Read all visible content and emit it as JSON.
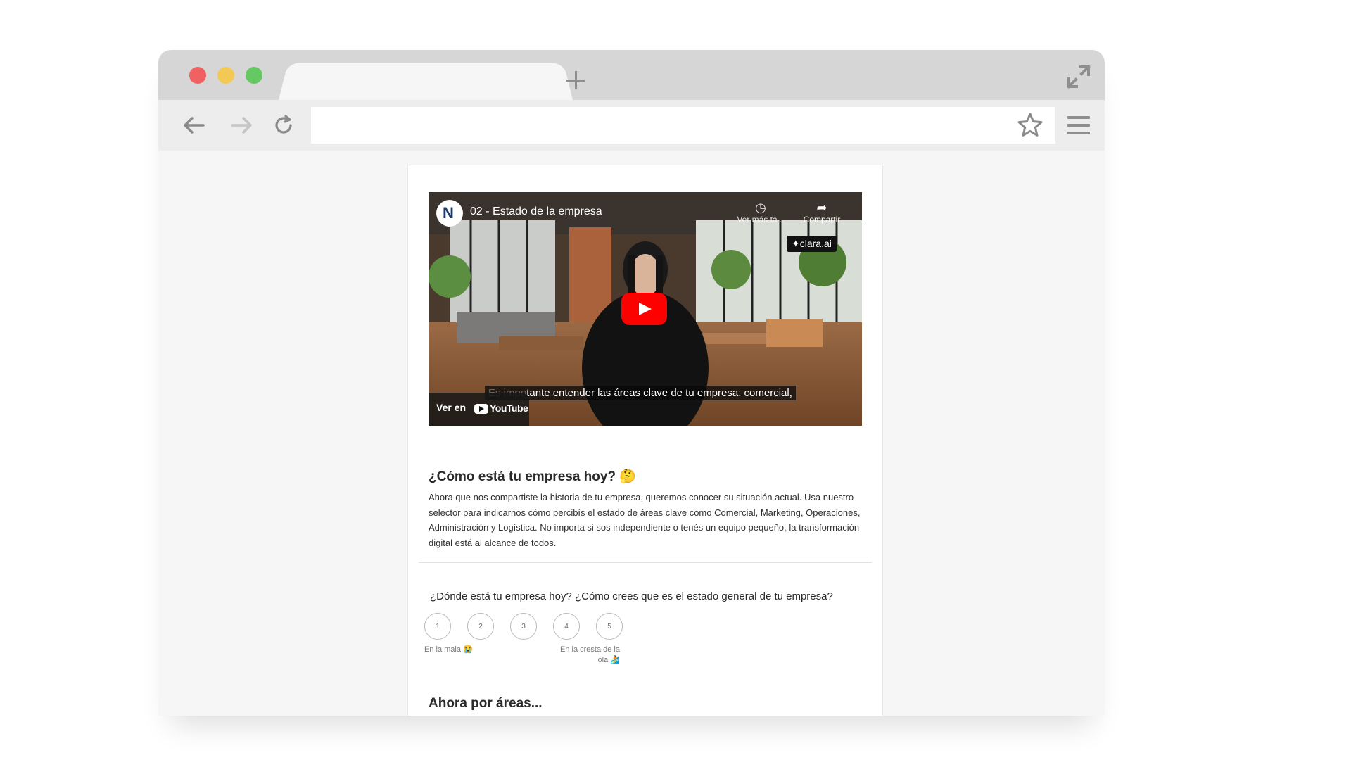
{
  "browser": {
    "colors": {
      "close": "#f06262",
      "minimize": "#f3c955",
      "maximize": "#65c863"
    },
    "icons": {
      "back": "arrow-left-icon",
      "forward": "arrow-right-icon",
      "reload": "reload-icon",
      "bookmark": "star-icon",
      "menu": "hamburger-menu-icon",
      "new_tab": "plus-icon",
      "fullscreen": "expand-icon"
    },
    "url": ""
  },
  "video": {
    "title": "02 - Estado de la empresa",
    "watch_later_label": "Ver más ta...",
    "share_label": "Compartir",
    "brand_badge": "✦clara.ai",
    "caption_dim": "Es impo",
    "caption_text": "tante entender las áreas clave de tu empresa: comercial,",
    "watch_on_label": "Ver en",
    "youtube_label": "YouTube",
    "play_color": "#ff0000"
  },
  "intro": {
    "title": "¿Cómo está tu empresa hoy? 🤔",
    "description": "Ahora que nos compartiste la historia de tu empresa, queremos conocer su situación actual. Usa nuestro selector para indicarnos cómo percibís el estado de áreas clave como Comercial, Marketing, Operaciones, Administración y Logística. No importa si sos independiente o tenés un equipo pequeño, la transformación digital está al alcance de todos."
  },
  "question": {
    "text": "¿Dónde está tu empresa hoy? ¿Cómo crees que es el estado general de tu empresa?",
    "options": [
      "1",
      "2",
      "3",
      "4",
      "5"
    ],
    "low_label": "En la mala 😭",
    "high_label": "En la cresta de la ola 🏄"
  },
  "next_section": {
    "title": "Ahora por áreas..."
  }
}
